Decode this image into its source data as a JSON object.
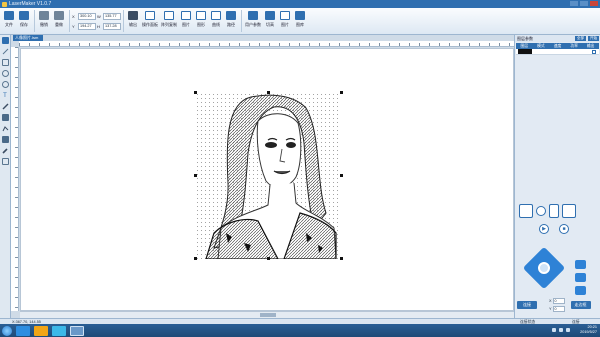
{
  "window": {
    "title": "LaserMaker V1.0.7"
  },
  "toolbar": {
    "buttons": [
      {
        "label": "文件",
        "icon": "folder-icon"
      },
      {
        "label": "保存",
        "icon": "save-icon"
      },
      {
        "label": "撤销",
        "icon": "undo-icon"
      },
      {
        "label": "重做",
        "icon": "redo-icon"
      }
    ],
    "coords": {
      "x_label": "X",
      "x_value": "300.10",
      "y_label": "Y",
      "y_value": "194.27",
      "w_label": "W",
      "w_value": "135.77",
      "h_label": "H",
      "h_value": "137.28"
    },
    "more_buttons": [
      {
        "label": "输出",
        "icon": "lock-icon"
      },
      {
        "label": "操作面板",
        "icon": "monitor-icon"
      },
      {
        "label": "阵列复制",
        "icon": "array-icon"
      },
      {
        "label": "图片",
        "icon": "image-icon"
      },
      {
        "label": "图形",
        "icon": "shapes-icon"
      },
      {
        "label": "曲线",
        "icon": "curve-icon"
      },
      {
        "label": "路径",
        "icon": "path-icon"
      },
      {
        "label": "用户参数",
        "icon": "wrench-icon"
      },
      {
        "label": "切高",
        "icon": "grid-icon"
      },
      {
        "label": "图片",
        "icon": "picture-icon"
      },
      {
        "label": "图库",
        "icon": "library-icon"
      }
    ]
  },
  "document": {
    "tab_label": "人像照片.lsm"
  },
  "right_panel": {
    "header": "图层参数",
    "mini_buttons": [
      "全部",
      "开始"
    ],
    "layer_columns": [
      "图层",
      "模式",
      "速度",
      "功率",
      "输出"
    ],
    "layer_row": {
      "swatch_color": "#111111",
      "mode": "",
      "output_checked": true
    }
  },
  "controls": {
    "play_icon": "▶",
    "stop_icon": "■",
    "start_button": "连接",
    "frame_button": "走边框",
    "x_label": "X",
    "x_value": "0",
    "y_label": "Y",
    "y_value": "0"
  },
  "statusbar": {
    "coords": "X:367.70, 144.55",
    "right_a": "连接状态",
    "right_b": "连接"
  },
  "taskbar": {
    "time": "20:21",
    "date": "2019/5/27"
  },
  "colors": {
    "accent": "#2f6fb0",
    "dpad": "#2e82d6"
  }
}
